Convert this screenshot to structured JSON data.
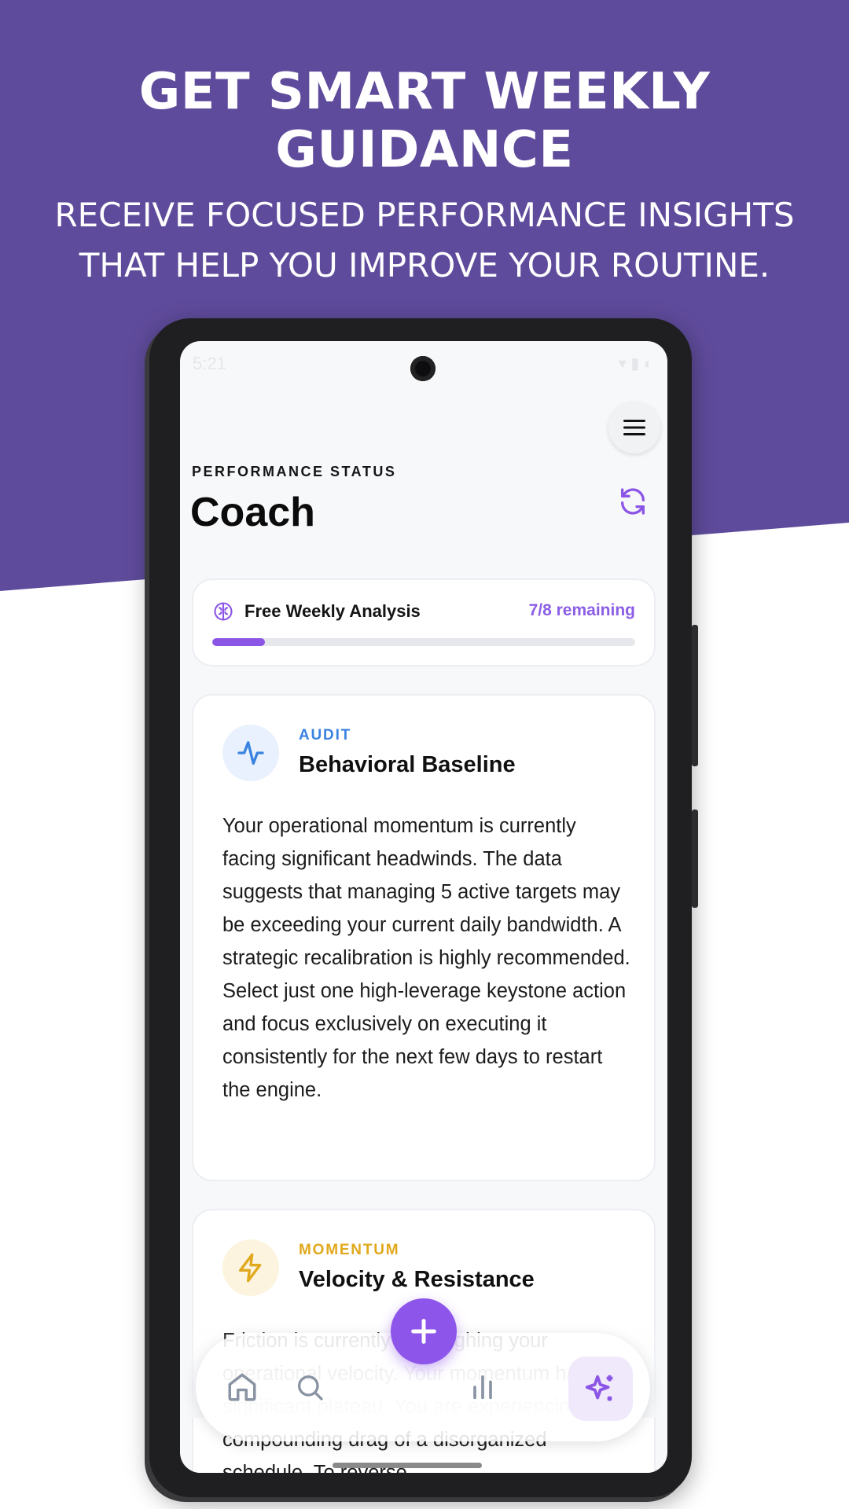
{
  "promo": {
    "headline": "GET SMART WEEKLY GUIDANCE",
    "subline_1": "RECEIVE FOCUSED PERFORMANCE INSIGHTS",
    "subline_2": "THAT HELP YOU IMPROVE YOUR ROUTINE.",
    "background_color": "#5f4b9b"
  },
  "status_bar": {
    "time": "5:21"
  },
  "header": {
    "eyebrow": "PERFORMANCE STATUS",
    "title": "Coach",
    "menu_icon": "hamburger-icon",
    "refresh_icon": "refresh-icon"
  },
  "analysis": {
    "label": "Free Weekly Analysis",
    "remaining": "7/8 remaining",
    "progress_fraction": 0.125,
    "icon": "brain-icon",
    "accent": "#8b55e6"
  },
  "cards": [
    {
      "tag": "AUDIT",
      "tag_color": "#3a82e0",
      "title": "Behavioral Baseline",
      "icon": "activity-icon",
      "body": "Your operational momentum is currently facing significant headwinds. The data suggests that managing 5 active targets may be exceeding your current daily bandwidth. A strategic recalibration is highly recommended. Select just one high-leverage keystone action and focus exclusively on executing it consistently for the next few days to restart the engine."
    },
    {
      "tag": "MOMENTUM",
      "tag_color": "#e0a81c",
      "title": "Velocity & Resistance",
      "icon": "lightning-icon",
      "body": "Friction is currently outweighing your operational velocity. Your momentum has hit a significant plateau. You are experiencing the compounding drag of a disorganized schedule. To reverse"
    }
  ],
  "nav": {
    "items": [
      "home-icon",
      "search-icon",
      "chart-icon",
      "sparkles-icon"
    ],
    "active": "sparkles-icon",
    "fab_icon": "plus-icon"
  }
}
